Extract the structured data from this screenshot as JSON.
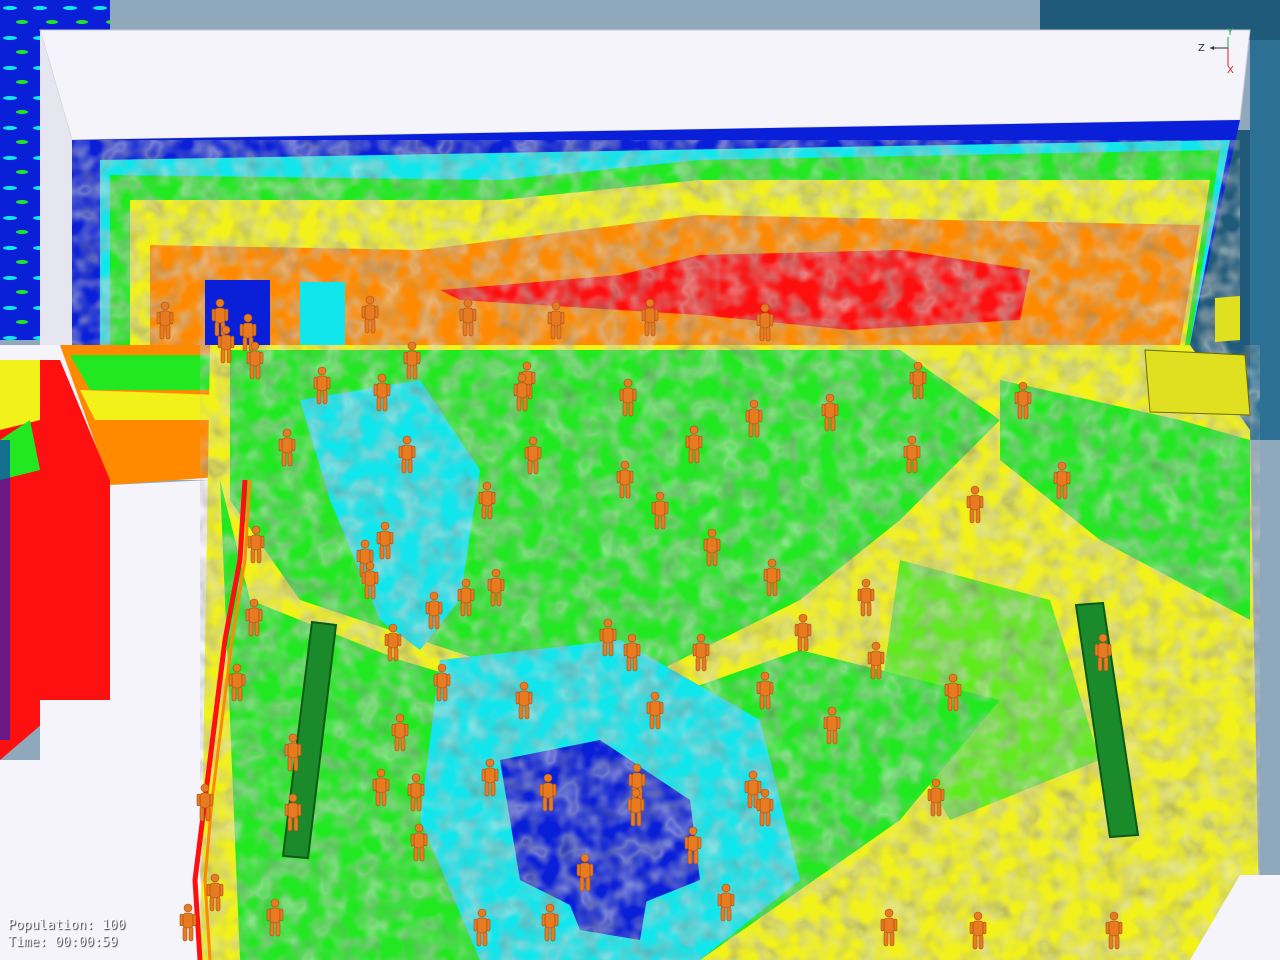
{
  "axes": {
    "z": "Z",
    "y": "Y",
    "x": "X"
  },
  "overlay": {
    "population_label": "Population:",
    "population_value": "100",
    "time_label": "Time:",
    "time_value": "00:00:59"
  },
  "colors": {
    "background": "#8fa8bb",
    "wall": "#f4f4fa",
    "structure": "#1f5a7a",
    "band_1": "#0a1fd8",
    "band_2": "#11e6ec",
    "band_3": "#22e822",
    "band_4": "#f2f21a",
    "band_5": "#ff8a00",
    "band_6": "#ff1010",
    "agent": "#e87a20",
    "exit_marker": "#1a8a2a",
    "door_panel": "#e0e020"
  },
  "icons": {
    "agent": "person-icon",
    "exit": "exit-marker-icon"
  }
}
